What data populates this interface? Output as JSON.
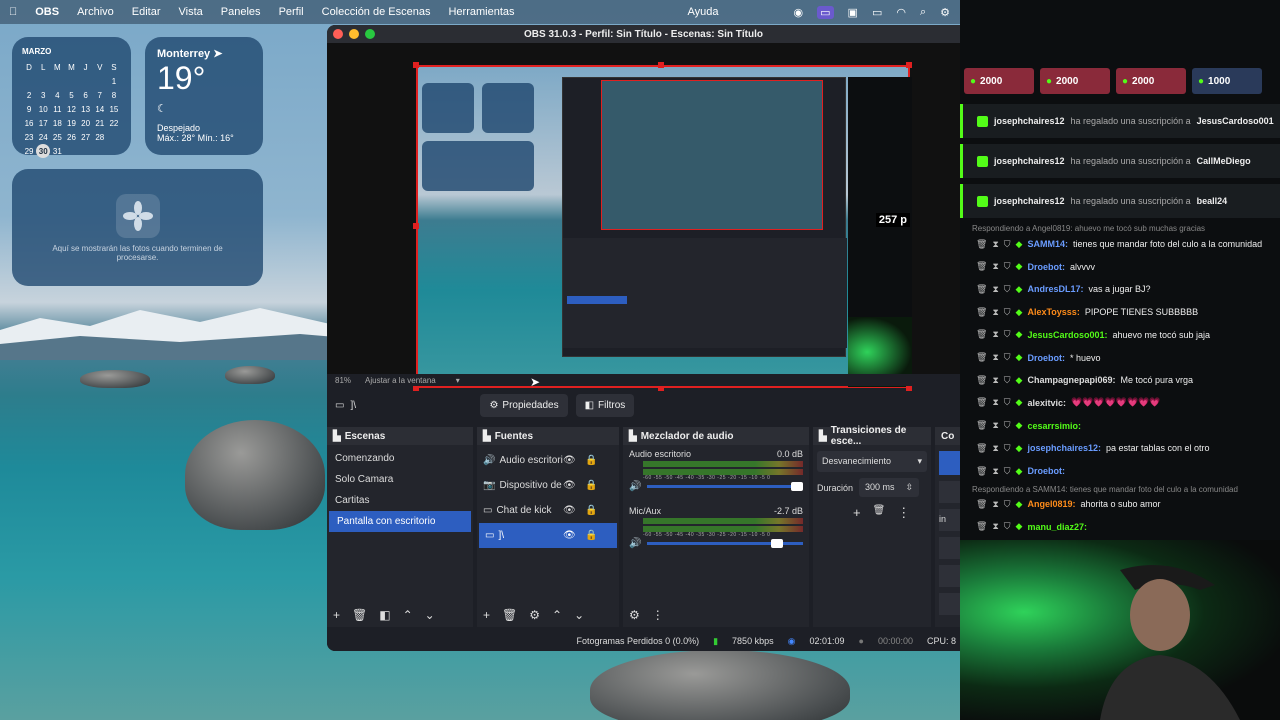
{
  "menubar": {
    "app": "OBS",
    "items": [
      "Archivo",
      "Editar",
      "Vista",
      "Paneles",
      "Perfil",
      "Colección de Escenas",
      "Herramientas",
      "Ayuda"
    ]
  },
  "calendar": {
    "month": "MARZO",
    "weekdays": [
      "D",
      "L",
      "M",
      "M",
      "J",
      "V",
      "S"
    ],
    "rows": [
      [
        "",
        "",
        "",
        "",
        "",
        "",
        "1"
      ],
      [
        "2",
        "3",
        "4",
        "5",
        "6",
        "7",
        "8"
      ],
      [
        "9",
        "10",
        "11",
        "12",
        "13",
        "14",
        "15"
      ],
      [
        "16",
        "17",
        "18",
        "19",
        "20",
        "21",
        "22"
      ],
      [
        "23",
        "24",
        "25",
        "26",
        "27",
        "28",
        ""
      ],
      [
        "29",
        "30",
        "31",
        "",
        "",
        "",
        ""
      ]
    ],
    "today": "30"
  },
  "weather": {
    "city": "Monterrey",
    "temp": "19°",
    "condition": "Despejado",
    "range": "Máx.: 28° Mín.: 16°"
  },
  "photos_widget": {
    "text": "Aquí se mostrarán las fotos cuando terminen de procesarse."
  },
  "obs": {
    "title": "OBS 31.0.3 - Perfil: Sin Título - Escenas: Sin Título",
    "zoom": "81%",
    "fit": "Ajustar a la ventana",
    "current_source": "]\\",
    "properties_btn": "Propiedades",
    "filters_btn": "Filtros",
    "docks": {
      "scenes_title": "Escenas",
      "sources_title": "Fuentes",
      "mixer_title": "Mezclador de audio",
      "transitions_title": "Transiciones de esce...",
      "controls_title": "Co"
    },
    "scenes": [
      "Comenzando",
      "Solo Camara",
      "Cartitas",
      "Pantalla con escritorio"
    ],
    "selected_scene": "Pantalla con escritorio",
    "sources": [
      "Audio escritorio",
      "Dispositivo de c",
      "Chat de kick",
      "]\\"
    ],
    "mixer": [
      {
        "name": "Audio escritorio",
        "db": "0.0 dB",
        "level": 0.97
      },
      {
        "name": "Mic/Aux",
        "db": "-2.7 dB",
        "level": 0.85
      }
    ],
    "meter_ticks": "-60 -55 -50 -45 -40 -35 -30 -25 -20 -15 -10 -5 0",
    "transition": "Desvanecimiento",
    "duration_label": "Duración",
    "duration": "300 ms",
    "controls_fragment": "in",
    "status": {
      "dropped": "Fotogramas Perdidos 0 (0.0%)",
      "bitrate": "7850 kbps",
      "rec_time": "02:01:09",
      "stream_time": "00:00:00",
      "cpu": "CPU: 8"
    }
  },
  "chat": {
    "gifts": [
      {
        "amount": "2000",
        "color": "#8a2a3a"
      },
      {
        "amount": "2000",
        "color": "#8a2a3a"
      },
      {
        "amount": "2000",
        "color": "#8a2a3a"
      },
      {
        "amount": "1000",
        "color": "#2a3a5a"
      }
    ],
    "subs": [
      {
        "user": "josephchaires12",
        "text": "ha regalado una suscripción a",
        "target": "JesusCardoso001"
      },
      {
        "user": "josephchaires12",
        "text": "ha regalado una suscripción a",
        "target": "CallMeDiego"
      },
      {
        "user": "josephchaires12",
        "text": "ha regalado una suscripción a",
        "target": "beall24"
      }
    ],
    "reply1": "Respondiendo a Angel0819: ahuevo me tocó sub muchas gracias",
    "messages": [
      {
        "user": "SAMM14:",
        "text": "tienes que mandar foto del culo a la comunidad",
        "color": "#6a9cff"
      },
      {
        "user": "Droebot:",
        "text": "alvvvv",
        "color": "#6a9cff"
      },
      {
        "user": "AndresDL17:",
        "text": "vas a jugar BJ?",
        "color": "#6a9cff"
      },
      {
        "user": "AlexToysss:",
        "text": "PIPOPE TIENES SUBBBBB",
        "color": "#ff8c1a"
      },
      {
        "user": "JesusCardoso001:",
        "text": "ahuevo me tocó sub jaja",
        "color": "#53fc18"
      },
      {
        "user": "Droebot:",
        "text": "* huevo",
        "color": "#6a9cff"
      },
      {
        "user": "Champagnepapi069:",
        "text": "Me tocó pura vrga",
        "color": "#dddddd"
      },
      {
        "user": "alexitvic:",
        "text": "💗💗💗💗💗💗💗💗",
        "color": "#dddddd"
      },
      {
        "user": "cesarrsimio:",
        "text": "",
        "color": "#53fc18"
      },
      {
        "user": "josephchaires12:",
        "text": "pa estar tablas con el otro",
        "color": "#6a9cff"
      },
      {
        "user": "Droebot:",
        "text": "",
        "color": "#6a9cff"
      }
    ],
    "reply2": "Respondiendo a SAMM14: tienes que mandar foto del culo a la comunidad",
    "messages2": [
      {
        "user": "Angel0819:",
        "text": "ahorita o subo amor",
        "color": "#ff8c1a"
      },
      {
        "user": "manu_diaz27:",
        "text": "",
        "color": "#53fc18"
      }
    ]
  }
}
